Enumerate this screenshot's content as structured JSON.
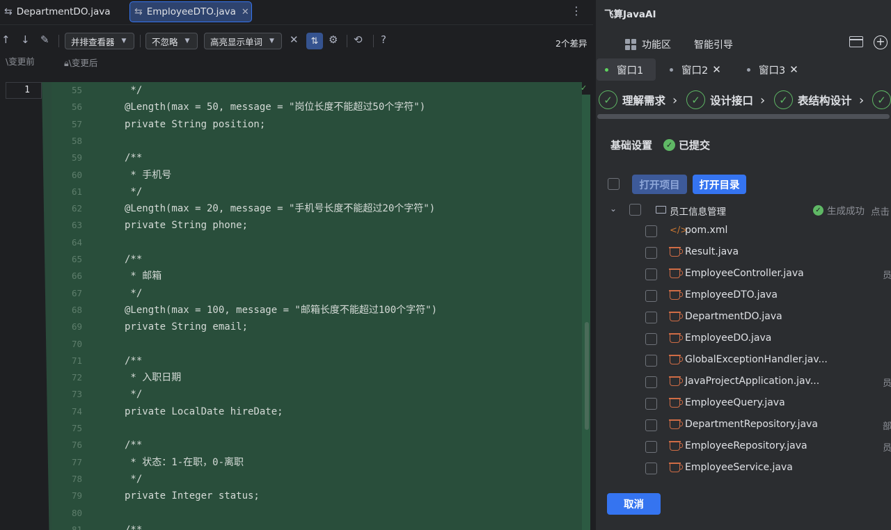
{
  "tabs": [
    {
      "label": "DepartmentDO.java"
    },
    {
      "label": "EmployeeDTO.java",
      "active": true
    }
  ],
  "toolbar": {
    "viewer": "并排查看器",
    "ignore": "不忽略",
    "highlight": "高亮显示单词",
    "diff_count": "2个差异"
  },
  "paths": {
    "before": "\\变更前",
    "after": "\\变更后"
  },
  "editor": {
    "left_line": "1",
    "lines": [
      {
        "n": "55",
        "t": " */"
      },
      {
        "n": "56",
        "t": "@Length(max = 50, message = \"岗位长度不能超过50个字符\")"
      },
      {
        "n": "57",
        "t": "private String position;"
      },
      {
        "n": "58",
        "t": ""
      },
      {
        "n": "59",
        "t": "/**"
      },
      {
        "n": "60",
        "t": " * 手机号"
      },
      {
        "n": "61",
        "t": " */"
      },
      {
        "n": "62",
        "t": "@Length(max = 20, message = \"手机号长度不能超过20个字符\")"
      },
      {
        "n": "63",
        "t": "private String phone;"
      },
      {
        "n": "64",
        "t": ""
      },
      {
        "n": "65",
        "t": "/**"
      },
      {
        "n": "66",
        "t": " * 邮箱"
      },
      {
        "n": "67",
        "t": " */"
      },
      {
        "n": "68",
        "t": "@Length(max = 100, message = \"邮箱长度不能超过100个字符\")"
      },
      {
        "n": "69",
        "t": "private String email;"
      },
      {
        "n": "70",
        "t": ""
      },
      {
        "n": "71",
        "t": "/**"
      },
      {
        "n": "72",
        "t": " * 入职日期"
      },
      {
        "n": "73",
        "t": " */"
      },
      {
        "n": "74",
        "t": "private LocalDate hireDate;"
      },
      {
        "n": "75",
        "t": ""
      },
      {
        "n": "76",
        "t": "/**"
      },
      {
        "n": "77",
        "t": " * 状态：1-在职，0-离职"
      },
      {
        "n": "78",
        "t": " */"
      },
      {
        "n": "79",
        "t": "private Integer status;"
      },
      {
        "n": "80",
        "t": ""
      },
      {
        "n": "81",
        "t": "/**"
      }
    ]
  },
  "panel": {
    "title": "飞算JavaAI",
    "nav": {
      "func": "功能区",
      "guide": "智能引导"
    },
    "windows": [
      "窗口1",
      "窗口2",
      "窗口3"
    ],
    "steps": [
      "理解需求",
      "设计接口",
      "表结构设计"
    ],
    "basic": {
      "label": "基础设置",
      "status": "已提交"
    },
    "buttons": {
      "open_project": "打开项目",
      "open_dir": "打开目录",
      "cancel": "取消"
    },
    "folder": {
      "name": "员工信息管理",
      "status": "生成成功",
      "hint": "点击"
    },
    "files": [
      {
        "name": "pom.xml",
        "type": "xml",
        "side": ""
      },
      {
        "name": "Result.java",
        "type": "java",
        "side": ""
      },
      {
        "name": "EmployeeController.java",
        "type": "java",
        "side": "员"
      },
      {
        "name": "EmployeeDTO.java",
        "type": "java",
        "side": ""
      },
      {
        "name": "DepartmentDO.java",
        "type": "java",
        "side": ""
      },
      {
        "name": "EmployeeDO.java",
        "type": "java",
        "side": ""
      },
      {
        "name": "GlobalExceptionHandler.jav...",
        "type": "java",
        "side": ""
      },
      {
        "name": "JavaProjectApplication.jav...",
        "type": "java",
        "side": "员"
      },
      {
        "name": "EmployeeQuery.java",
        "type": "java",
        "side": ""
      },
      {
        "name": "DepartmentRepository.java",
        "type": "java",
        "side": "部"
      },
      {
        "name": "EmployeeRepository.java",
        "type": "java",
        "side": "员"
      },
      {
        "name": "EmployeeService.java",
        "type": "java",
        "side": ""
      }
    ]
  }
}
